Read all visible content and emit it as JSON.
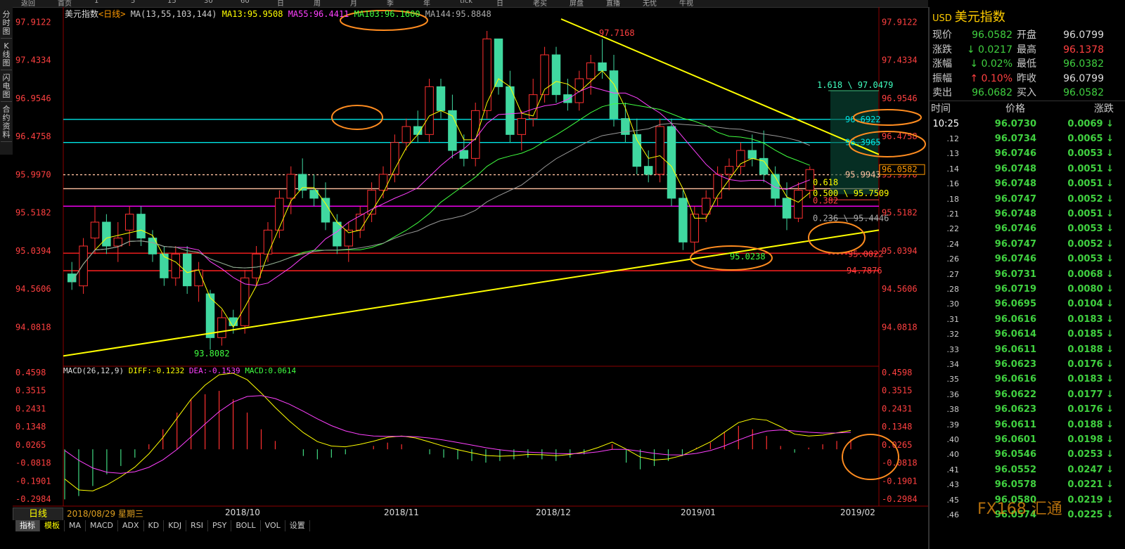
{
  "topbar": {
    "items": [
      "返回",
      "首页",
      "1",
      "5",
      "15",
      "30",
      "60",
      "日",
      "周",
      "月",
      "季",
      "年",
      "tick",
      "日",
      "老买",
      "屏盘",
      "直播",
      "无忧",
      "牛视"
    ]
  },
  "side_tabs": [
    "分时图",
    "K线图",
    "闪电图",
    "合约资料"
  ],
  "legend": {
    "title": "美元指数",
    "period": "<日线>",
    "ma_params": "MA(13,55,103,144)",
    "ma13": "MA13:95.9508",
    "ma55": "MA55:96.4411",
    "ma103": "MA103:96.1600",
    "ma144": "MA144:95.8848"
  },
  "macd_legend": {
    "params": "MACD(26,12,9)",
    "diff": "DIFF:-0.1232",
    "dea": "DEA:-0.1539",
    "macd": "MACD:0.0614"
  },
  "price_axis": [
    "97.9122",
    "97.4334",
    "96.9546",
    "96.4758",
    "95.9970",
    "95.5182",
    "95.0394",
    "94.5606",
    "94.0818"
  ],
  "macd_axis": [
    "0.4598",
    "0.3515",
    "0.2431",
    "0.1348",
    "0.0265",
    "-0.0818",
    "-0.1901",
    "-0.2984"
  ],
  "current_price_tag": "96.0582",
  "annotations": {
    "high": "97.7168",
    "low_left": "93.8082",
    "low_mid": "95.0238",
    "fib_1618": "1.618 \\ 97.0479",
    "lvl_96_6922": "96.6922",
    "lvl_96_3965": "96.3965",
    "lvl_95_9943": "95.9943",
    "fib_0618": "0.618",
    "fib_0500": "0.500 \\ 95.7509",
    "fib_0382": "0.382",
    "fib_0236": "0.236 \\ 95.4446",
    "lvl_95_0022": "95.0022",
    "lvl_94_7876": "94.7876"
  },
  "chart_data": {
    "type": "candlestick",
    "ylim": [
      93.6,
      98.1
    ],
    "candles_sampled_ohlc_note_free": [
      [
        94.75,
        94.9,
        94.55,
        94.65
      ],
      [
        94.6,
        95.2,
        94.5,
        95.1
      ],
      [
        95.2,
        95.6,
        95.0,
        95.4
      ],
      [
        95.4,
        95.5,
        95.0,
        95.1
      ],
      [
        95.1,
        95.4,
        94.9,
        95.2
      ],
      [
        95.3,
        95.6,
        95.1,
        95.5
      ],
      [
        95.5,
        95.6,
        95.1,
        95.2
      ],
      [
        95.2,
        95.3,
        94.9,
        95.0
      ],
      [
        95.0,
        95.1,
        94.6,
        94.7
      ],
      [
        94.7,
        95.1,
        94.6,
        95.0
      ],
      [
        95.0,
        95.1,
        94.5,
        94.6
      ],
      [
        94.6,
        94.9,
        94.4,
        94.8
      ],
      [
        94.5,
        94.55,
        93.8,
        93.95
      ],
      [
        93.95,
        94.3,
        93.85,
        94.2
      ],
      [
        94.2,
        94.3,
        94.0,
        94.1
      ],
      [
        94.1,
        94.8,
        94.0,
        94.7
      ],
      [
        94.7,
        95.1,
        94.6,
        95.0
      ],
      [
        95.0,
        95.4,
        94.9,
        95.3
      ],
      [
        95.3,
        95.8,
        95.2,
        95.7
      ],
      [
        95.7,
        96.1,
        95.5,
        96.0
      ],
      [
        96.0,
        96.2,
        95.7,
        95.8
      ],
      [
        95.8,
        96.0,
        95.6,
        95.7
      ],
      [
        95.7,
        95.9,
        95.3,
        95.4
      ],
      [
        95.4,
        95.5,
        95.0,
        95.1
      ],
      [
        95.1,
        95.4,
        94.9,
        95.3
      ],
      [
        95.3,
        95.6,
        95.2,
        95.5
      ],
      [
        95.5,
        95.9,
        95.4,
        95.8
      ],
      [
        95.8,
        96.1,
        95.7,
        96.0
      ],
      [
        96.0,
        96.5,
        95.9,
        96.4
      ],
      [
        96.4,
        96.7,
        96.3,
        96.6
      ],
      [
        96.6,
        96.8,
        96.4,
        96.5
      ],
      [
        96.5,
        97.2,
        96.4,
        97.1
      ],
      [
        97.1,
        97.2,
        96.7,
        96.8
      ],
      [
        96.8,
        97.0,
        96.2,
        96.3
      ],
      [
        96.3,
        96.5,
        96.1,
        96.2
      ],
      [
        96.2,
        96.9,
        96.1,
        96.8
      ],
      [
        96.8,
        97.8,
        96.7,
        97.7
      ],
      [
        97.7,
        97.7,
        97.0,
        97.1
      ],
      [
        97.1,
        97.3,
        96.4,
        96.5
      ],
      [
        96.5,
        96.8,
        96.3,
        96.7
      ],
      [
        96.7,
        97.2,
        96.6,
        97.0
      ],
      [
        97.0,
        97.6,
        96.9,
        97.5
      ],
      [
        97.5,
        97.6,
        96.9,
        97.0
      ],
      [
        97.0,
        97.2,
        96.8,
        96.9
      ],
      [
        96.9,
        97.3,
        96.8,
        97.2
      ],
      [
        97.2,
        97.5,
        97.0,
        97.4
      ],
      [
        97.4,
        97.7,
        97.2,
        97.3
      ],
      [
        97.3,
        97.5,
        96.6,
        96.7
      ],
      [
        96.7,
        96.9,
        96.4,
        96.5
      ],
      [
        96.5,
        96.7,
        96.0,
        96.1
      ],
      [
        96.1,
        96.3,
        95.9,
        96.0
      ],
      [
        96.0,
        96.7,
        95.9,
        96.6
      ],
      [
        96.6,
        96.7,
        95.6,
        95.7
      ],
      [
        95.7,
        95.8,
        95.05,
        95.15
      ],
      [
        95.15,
        95.6,
        95.0,
        95.5
      ],
      [
        95.5,
        95.8,
        95.4,
        95.7
      ],
      [
        95.7,
        96.1,
        95.6,
        96.0
      ],
      [
        96.0,
        96.2,
        95.8,
        96.1
      ],
      [
        96.1,
        96.4,
        96.0,
        96.3
      ],
      [
        96.3,
        96.5,
        96.1,
        96.2
      ],
      [
        96.2,
        96.55,
        95.9,
        96.0
      ],
      [
        96.0,
        96.1,
        95.6,
        95.7
      ],
      [
        95.7,
        95.9,
        95.3,
        95.45
      ],
      [
        95.45,
        95.9,
        95.4,
        95.8
      ],
      [
        95.8,
        96.1,
        95.7,
        96.06
      ]
    ],
    "macd_hist_sampled": [
      -0.3,
      -0.28,
      -0.22,
      -0.15,
      -0.1,
      -0.05,
      0.03,
      0.12,
      0.22,
      0.3,
      0.33,
      0.35,
      0.3,
      0.22,
      0.12,
      0.05,
      0.0,
      -0.04,
      -0.06,
      -0.05,
      -0.03,
      0.0,
      0.02,
      0.04,
      0.03,
      0.0,
      -0.03,
      -0.05,
      -0.06,
      -0.07,
      -0.08,
      -0.07,
      -0.06,
      -0.05,
      -0.06,
      -0.07,
      -0.05,
      -0.03,
      0.0,
      0.03,
      -0.08,
      -0.12,
      -0.1,
      -0.07,
      -0.04,
      0.01,
      0.04,
      0.1,
      0.14,
      0.12,
      0.08,
      0.02,
      -0.02,
      0.01,
      0.03,
      0.05,
      0.06
    ]
  },
  "bottom": {
    "period_button": "日线",
    "date_label": "2018/08/29 星期三",
    "date_ticks": [
      "2018/10",
      "2018/11",
      "2018/12",
      "2019/01",
      "2019/02"
    ],
    "indicator_tabs": [
      "指标",
      "模板",
      "MA",
      "MACD",
      "ADX",
      "KD",
      "KDJ",
      "RSI",
      "PSY",
      "BOLL",
      "VOL",
      "设置"
    ]
  },
  "quote_panel": {
    "code": "USD",
    "name": "美元指数",
    "rows": [
      {
        "l1": "现价",
        "v1": "96.0582",
        "c1": "g",
        "l2": "开盘",
        "v2": "96.0799",
        "c2": "w"
      },
      {
        "l1": "涨跌",
        "v1": "↓ 0.0217",
        "c1": "g",
        "l2": "最高",
        "v2": "96.1378",
        "c2": "r"
      },
      {
        "l1": "涨幅",
        "v1": "↓ 0.02%",
        "c1": "g",
        "l2": "最低",
        "v2": "96.0382",
        "c2": "g"
      },
      {
        "l1": "振幅",
        "v1": "↑ 0.10%",
        "c1": "r",
        "l2": "昨收",
        "v2": "96.0799",
        "c2": "w"
      },
      {
        "l1": "卖出",
        "v1": "96.0682",
        "c1": "g",
        "l2": "买入",
        "v2": "96.0582",
        "c2": "g"
      }
    ],
    "tick_headers": [
      "时间",
      "价格",
      "涨跌"
    ],
    "ticks": [
      {
        "t": "10:25",
        "p": "96.0730",
        "c": "0.0069 ↓"
      },
      {
        "t": ".12",
        "p": "96.0734",
        "c": "0.0065 ↓"
      },
      {
        "t": ".13",
        "p": "96.0746",
        "c": "0.0053 ↓"
      },
      {
        "t": ".14",
        "p": "96.0748",
        "c": "0.0051 ↓"
      },
      {
        "t": ".16",
        "p": "96.0748",
        "c": "0.0051 ↓"
      },
      {
        "t": ".18",
        "p": "96.0747",
        "c": "0.0052 ↓"
      },
      {
        "t": ".21",
        "p": "96.0748",
        "c": "0.0051 ↓"
      },
      {
        "t": ".22",
        "p": "96.0746",
        "c": "0.0053 ↓"
      },
      {
        "t": ".24",
        "p": "96.0747",
        "c": "0.0052 ↓"
      },
      {
        "t": ".26",
        "p": "96.0746",
        "c": "0.0053 ↓"
      },
      {
        "t": ".27",
        "p": "96.0731",
        "c": "0.0068 ↓"
      },
      {
        "t": ".28",
        "p": "96.0719",
        "c": "0.0080 ↓"
      },
      {
        "t": ".30",
        "p": "96.0695",
        "c": "0.0104 ↓"
      },
      {
        "t": ".31",
        "p": "96.0616",
        "c": "0.0183 ↓"
      },
      {
        "t": ".32",
        "p": "96.0614",
        "c": "0.0185 ↓"
      },
      {
        "t": ".33",
        "p": "96.0611",
        "c": "0.0188 ↓"
      },
      {
        "t": ".34",
        "p": "96.0623",
        "c": "0.0176 ↓"
      },
      {
        "t": ".35",
        "p": "96.0616",
        "c": "0.0183 ↓"
      },
      {
        "t": ".36",
        "p": "96.0622",
        "c": "0.0177 ↓"
      },
      {
        "t": ".38",
        "p": "96.0623",
        "c": "0.0176 ↓"
      },
      {
        "t": ".39",
        "p": "96.0611",
        "c": "0.0188 ↓"
      },
      {
        "t": ".40",
        "p": "96.0601",
        "c": "0.0198 ↓"
      },
      {
        "t": ".40",
        "p": "96.0546",
        "c": "0.0253 ↓"
      },
      {
        "t": ".41",
        "p": "96.0552",
        "c": "0.0247 ↓"
      },
      {
        "t": ".43",
        "p": "96.0578",
        "c": "0.0221 ↓"
      },
      {
        "t": ".45",
        "p": "96.0580",
        "c": "0.0219 ↓"
      },
      {
        "t": ".46",
        "p": "96.0574",
        "c": "0.0225 ↓"
      }
    ]
  },
  "watermark": "FX168 汇通"
}
